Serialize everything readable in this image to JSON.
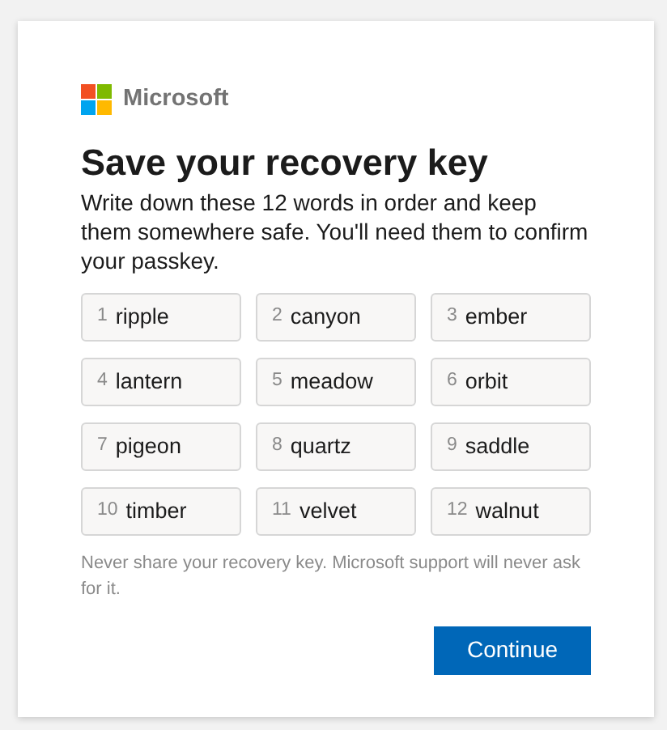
{
  "brand": {
    "name": "Microsoft"
  },
  "title": "Save your recovery key",
  "description": "Write down these 12 words in order and keep them somewhere safe. You'll need them to confirm your passkey.",
  "words": [
    {
      "number": "1",
      "word": "ripple"
    },
    {
      "number": "2",
      "word": "canyon"
    },
    {
      "number": "3",
      "word": "ember"
    },
    {
      "number": "4",
      "word": "lantern"
    },
    {
      "number": "5",
      "word": "meadow"
    },
    {
      "number": "6",
      "word": "orbit"
    },
    {
      "number": "7",
      "word": "pigeon"
    },
    {
      "number": "8",
      "word": "quartz"
    },
    {
      "number": "9",
      "word": "saddle"
    },
    {
      "number": "10",
      "word": "timber"
    },
    {
      "number": "11",
      "word": "velvet"
    },
    {
      "number": "12",
      "word": "walnut"
    }
  ],
  "warning": "Never share your recovery key. Microsoft support will never ask for it.",
  "buttons": [
    {
      "label": "Continue",
      "kind": "primary"
    }
  ]
}
